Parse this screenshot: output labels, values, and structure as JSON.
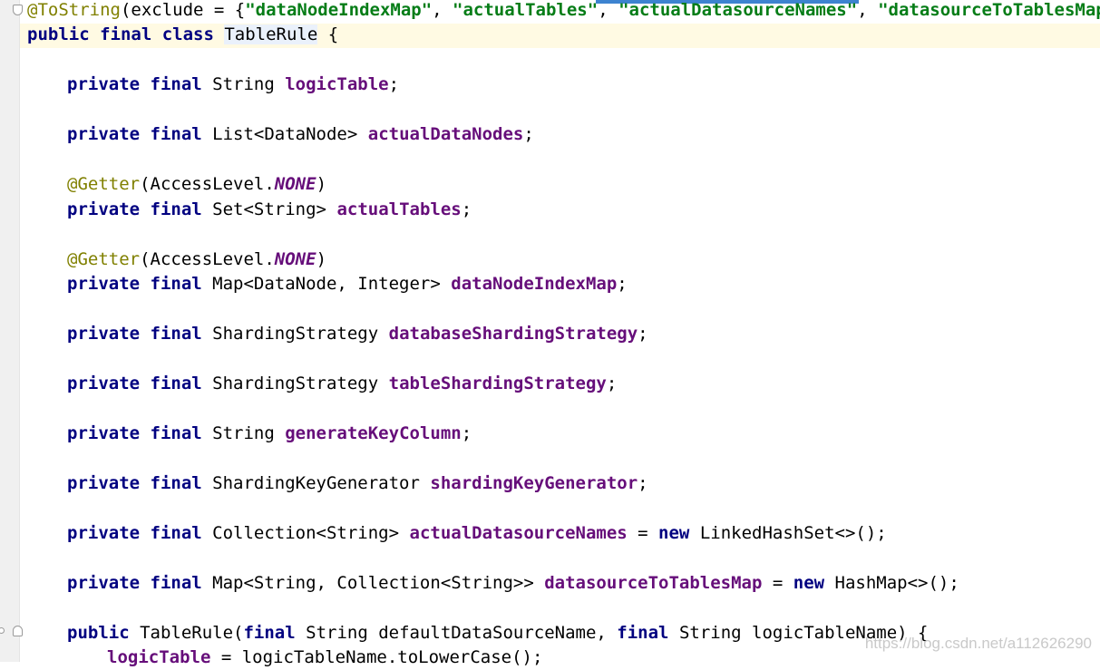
{
  "editor": {
    "line1": {
      "annotation": "@ToString",
      "open": "(exclude = {",
      "s1": "\"dataNodeIndexMap\"",
      "comma1": ", ",
      "s2": "\"actualTables\"",
      "comma2": ", ",
      "s3": "\"actualDatasourceNames\"",
      "comma3": ", ",
      "s4": "\"datasourceToTablesMap\"",
      "close": "})"
    },
    "class_decl": {
      "kw": "public final class ",
      "name": "TableRule",
      "brace": " {"
    },
    "field_logic_table": {
      "kw": "private final ",
      "type": "String ",
      "name": "logicTable",
      "end": ";"
    },
    "field_actual_data_nodes": {
      "kw": "private final ",
      "type": "List<DataNode> ",
      "name": "actualDataNodes",
      "end": ";"
    },
    "getter1": {
      "annotation": "@Getter",
      "open": "(AccessLevel.",
      "value": "NONE",
      "close": ")"
    },
    "field_actual_tables": {
      "kw": "private final ",
      "type": "Set<String> ",
      "name": "actualTables",
      "end": ";"
    },
    "getter2": {
      "annotation": "@Getter",
      "open": "(AccessLevel.",
      "value": "NONE",
      "close": ")"
    },
    "field_data_node_index_map": {
      "kw": "private final ",
      "type": "Map<DataNode, Integer> ",
      "name": "dataNodeIndexMap",
      "end": ";"
    },
    "field_database_sharding": {
      "kw": "private final ",
      "type": "ShardingStrategy ",
      "name": "databaseShardingStrategy",
      "end": ";"
    },
    "field_table_sharding": {
      "kw": "private final ",
      "type": "ShardingStrategy ",
      "name": "tableShardingStrategy",
      "end": ";"
    },
    "field_generate_key": {
      "kw": "private final ",
      "type": "String ",
      "name": "generateKeyColumn",
      "end": ";"
    },
    "field_key_generator": {
      "kw": "private final ",
      "type": "ShardingKeyGenerator ",
      "name": "shardingKeyGenerator",
      "end": ";"
    },
    "field_ds_names": {
      "kw": "private final ",
      "type": "Collection<String> ",
      "name": "actualDatasourceNames",
      "eq": " = ",
      "new_kw": "new",
      "init": " LinkedHashSet<>();"
    },
    "field_ds_to_tables": {
      "kw": "private final ",
      "type": "Map<String, Collection<String>> ",
      "name": "datasourceToTablesMap",
      "eq": " = ",
      "new_kw": "new",
      "init": " HashMap<>();"
    },
    "ctor": {
      "kw": "public",
      "name": " TableRule(",
      "final1": "final",
      "p1": " String defaultDataSourceName, ",
      "final2": "final",
      "p2": " String logicTableName) {"
    },
    "ctor_body": {
      "name": "logicTable",
      "rest": " = logicTableName.toLowerCase();"
    }
  },
  "watermark": "https://blog.csdn.net/a112626290",
  "colors": {
    "keyword": "#000080",
    "string": "#067d17",
    "field": "#660e7a",
    "annotation": "#808000",
    "caret_line": "#fffae3"
  }
}
